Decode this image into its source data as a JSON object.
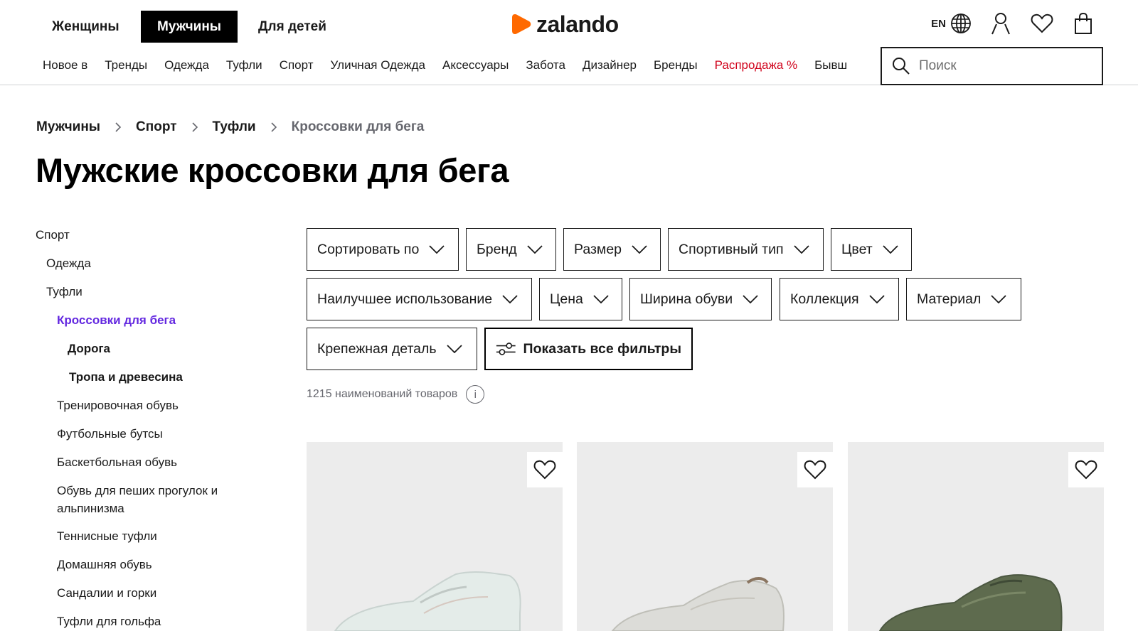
{
  "header": {
    "genders": [
      "Женщины",
      "Мужчины",
      "Для детей"
    ],
    "active_gender": "Мужчины",
    "logo_text": "zalando",
    "brand_color": "#ff6900",
    "lang": "EN",
    "icons": [
      "globe-icon",
      "user-icon",
      "heart-icon",
      "bag-icon"
    ]
  },
  "nav": {
    "items": [
      "Новое в",
      "Тренды",
      "Одежда",
      "Туфли",
      "Спорт",
      "Уличная Одежда",
      "Аксессуары",
      "Забота",
      "Дизайнер",
      "Бренды",
      "Распродажа %",
      "Бывш"
    ],
    "sale_color": "#d0021b"
  },
  "search": {
    "placeholder": "Поиск"
  },
  "breadcrumb": [
    "Мужчины",
    "Спорт",
    "Туфли",
    "Кроссовки для бега"
  ],
  "page_title": "Мужские кроссовки для бега",
  "sidebar": {
    "items": [
      {
        "label": "Спорт"
      },
      {
        "label": "Одежда"
      },
      {
        "label": "Туфли"
      },
      {
        "label": "Кроссовки для бега",
        "active": true
      },
      {
        "label": "Дорога"
      },
      {
        "label": "Тропа и древесина"
      },
      {
        "label": "Тренировочная обувь"
      },
      {
        "label": "Футбольные бутсы"
      },
      {
        "label": "Баскетбольная обувь"
      },
      {
        "label": "Обувь для пеших прогулок и альпинизма"
      },
      {
        "label": "Теннисные туфли"
      },
      {
        "label": "Домашняя обувь"
      },
      {
        "label": "Сандалии и горки"
      },
      {
        "label": "Туфли для гольфа"
      }
    ],
    "active_color": "#6328e0"
  },
  "filters": {
    "row1": [
      "Сортировать по",
      "Бренд",
      "Размер",
      "Спортивный тип",
      "Цвет"
    ],
    "row2": [
      "Наилучшее использование",
      "Цена",
      "Ширина обуви",
      "Коллекция",
      "Материал"
    ],
    "row3": [
      "Крепежная деталь"
    ],
    "show_all": "Показать все фильтры"
  },
  "results": {
    "count_text": "1215 наименований товаров"
  },
  "products": [
    {
      "color": "light-mint"
    },
    {
      "color": "light-grey"
    },
    {
      "color": "olive-green"
    }
  ]
}
